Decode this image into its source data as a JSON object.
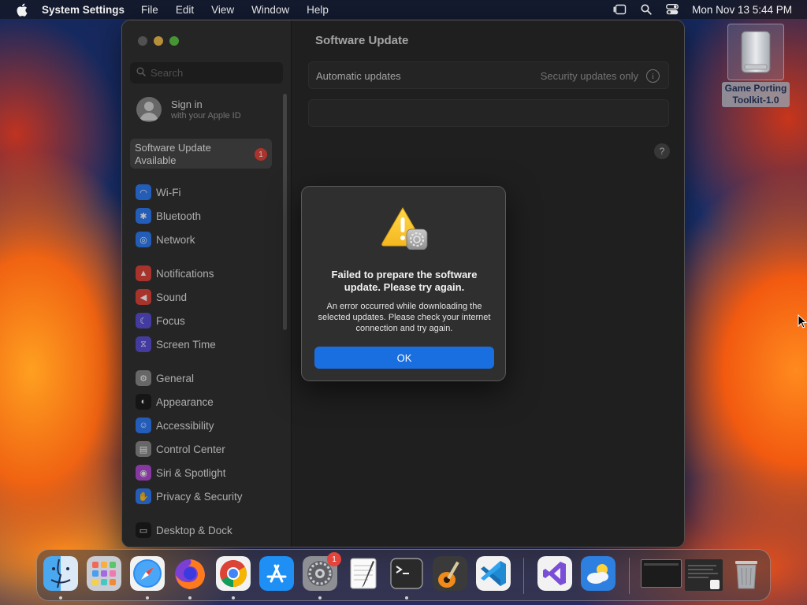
{
  "menubar": {
    "app_name": "System Settings",
    "menus": [
      "File",
      "Edit",
      "View",
      "Window",
      "Help"
    ],
    "clock": "Mon Nov 13  5:44 PM"
  },
  "desktop": {
    "disk_label_line1": "Game Porting",
    "disk_label_line2": "Toolkit-1.0"
  },
  "window": {
    "search_placeholder": "Search",
    "signin": {
      "title": "Sign in",
      "subtitle": "with your Apple ID"
    },
    "software_update_available": {
      "label": "Software Update Available",
      "badge": "1"
    },
    "sidebar_items": [
      {
        "label": "Wi-Fi",
        "icon": "wifi-icon",
        "color": "#2f7cf6"
      },
      {
        "label": "Bluetooth",
        "icon": "bluetooth-icon",
        "color": "#2f7cf6"
      },
      {
        "label": "Network",
        "icon": "globe-icon",
        "color": "#2f7cf6"
      },
      {
        "label": "Notifications",
        "icon": "bell-icon",
        "color": "#e0443b"
      },
      {
        "label": "Sound",
        "icon": "speaker-icon",
        "color": "#e0443b"
      },
      {
        "label": "Focus",
        "icon": "moon-icon",
        "color": "#5b4fd6"
      },
      {
        "label": "Screen Time",
        "icon": "hourglass-icon",
        "color": "#5b4fd6"
      },
      {
        "label": "General",
        "icon": "gear-icon",
        "color": "#8a8a8a"
      },
      {
        "label": "Appearance",
        "icon": "appearance-icon",
        "color": "#1c1c1c"
      },
      {
        "label": "Accessibility",
        "icon": "accessibility-icon",
        "color": "#2f7cf6"
      },
      {
        "label": "Control Center",
        "icon": "control-center-icon",
        "color": "#8a8a8a"
      },
      {
        "label": "Siri & Spotlight",
        "icon": "siri-icon",
        "color": "#b04bd6"
      },
      {
        "label": "Privacy & Security",
        "icon": "hand-icon",
        "color": "#2f7cf6"
      },
      {
        "label": "Desktop & Dock",
        "icon": "dock-icon",
        "color": "#1c1c1c"
      }
    ],
    "content": {
      "title": "Software Update",
      "automatic_updates_label": "Automatic updates",
      "automatic_updates_value": "Security updates only",
      "help": "?"
    }
  },
  "alert": {
    "title": "Failed to prepare the software update. Please try again.",
    "message": "An error occurred while downloading the selected updates. Please check your internet connection and try again.",
    "ok_label": "OK"
  },
  "dock": {
    "apps": [
      {
        "name": "finder",
        "running": true
      },
      {
        "name": "launchpad",
        "running": false
      },
      {
        "name": "safari",
        "running": true
      },
      {
        "name": "firefox",
        "running": true
      },
      {
        "name": "chrome",
        "running": true
      },
      {
        "name": "app-store",
        "running": false
      },
      {
        "name": "system-settings",
        "running": true,
        "badge": "1"
      },
      {
        "name": "textedit",
        "running": false
      },
      {
        "name": "terminal",
        "running": true
      },
      {
        "name": "garageband",
        "running": false
      },
      {
        "name": "vscode",
        "running": false
      },
      {
        "name": "visual-studio",
        "running": false
      },
      {
        "name": "weather",
        "running": false
      }
    ]
  }
}
